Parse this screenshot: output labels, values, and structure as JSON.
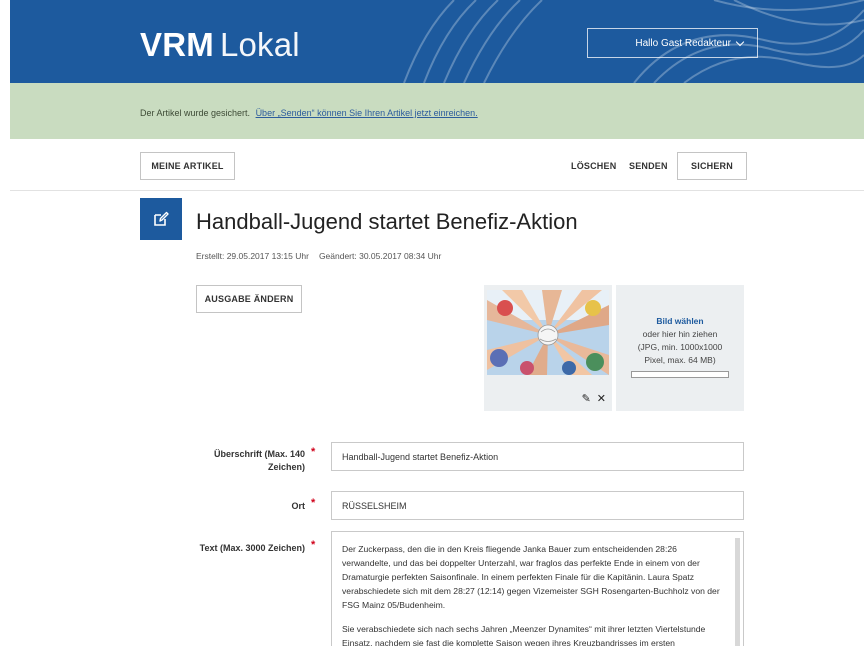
{
  "header": {
    "logo_bold": "VRM",
    "logo_light": "Lokal",
    "user_label": "Hallo Gast Redakteur"
  },
  "notice": {
    "text": "Der Artikel wurde gesichert.",
    "link": "Über „Senden“ können Sie Ihren Artikel jetzt einreichen."
  },
  "toolbar": {
    "my_articles": "MEINE ARTIKEL",
    "delete": "LÖSCHEN",
    "send": "SENDEN",
    "save": "SICHERN"
  },
  "article": {
    "title": "Handball-Jugend startet Benefiz-Aktion",
    "created": "Erstellt: 29.05.2017 13:15 Uhr",
    "changed": "Geändert: 30.05.2017 08:34 Uhr",
    "edition_button": "AUSGABE ÄNDERN"
  },
  "image": {
    "edit_icon": "pencil-icon",
    "remove_icon": "close-icon"
  },
  "upload": {
    "choose": "Bild wählen",
    "line1": "oder hier hin ziehen",
    "line2": "(JPG, min. 1000x1000",
    "line3": "Pixel, max. 64 MB)"
  },
  "form": {
    "headline_label_1": "Überschrift (Max. 140",
    "headline_label_2": "Zeichen)",
    "headline_value": "Handball-Jugend startet Benefiz-Aktion",
    "place_label": "Ort",
    "place_value": "RÜSSELSHEIM",
    "text_label": "Text (Max. 3000 Zeichen)",
    "required_mark": "*",
    "text_paragraph_1": "Der Zuckerpass, den die in den Kreis fliegende Janka Bauer zum entscheidenden 28:26 verwandelte, und das bei doppelter Unterzahl, war fraglos das perfekte Ende in einem von der Dramaturgie perfekten Saisonfinale. In einem perfekten Finale für die Kapitänin. Laura Spatz verabschiedete sich mit dem 28:27 (12:14) gegen Vizemeister SGH Rosengarten-Buchholz von der FSG Mainz 05/Budenheim.",
    "text_paragraph_2": "Sie verabschiedete sich nach sechs Jahren „Meenzer Dynamites“ mit ihrer letzten Viertelstunde Einsatz, nachdem sie fast die komplette Saison wegen ihres Kreuzbandrisses im ersten"
  },
  "colors": {
    "brand_blue": "#1d5a9e",
    "notice_green": "#c9dcc0",
    "required_red": "#d0021b"
  }
}
